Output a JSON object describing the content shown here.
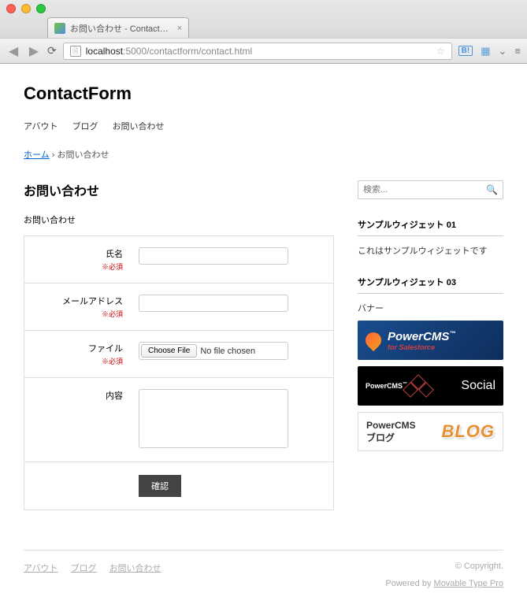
{
  "browser": {
    "tab_title": "お問い合わせ - ContactForm",
    "url_host": "localhost",
    "url_path": ":5000/contactform/contact.html",
    "bookmark_label": "B!"
  },
  "site": {
    "title": "ContactForm"
  },
  "nav": {
    "items": [
      "アバウト",
      "ブログ",
      "お問い合わせ"
    ]
  },
  "breadcrumb": {
    "home": "ホーム",
    "separator": "›",
    "current": "お問い合わせ"
  },
  "page": {
    "heading": "お問い合わせ",
    "subtext": "お問い合わせ"
  },
  "form": {
    "required_label": "※必須",
    "fields": {
      "name": {
        "label": "氏名"
      },
      "email": {
        "label": "メールアドレス"
      },
      "file": {
        "label": "ファイル",
        "button": "Choose File",
        "status": "No file chosen"
      },
      "content": {
        "label": "内容"
      }
    },
    "submit": "確認"
  },
  "sidebar": {
    "search_placeholder": "検索...",
    "widget1": {
      "title": "サンプルウィジェット 01",
      "body": "これはサンプルウィジェットです"
    },
    "widget3": {
      "title": "サンプルウィジェット 03",
      "body": "バナー"
    },
    "banners": {
      "b1_title": "PowerCMS",
      "b1_sub": "for Salesforce",
      "b2_left": "PowerCMS",
      "b2_right": "Social",
      "b3_left_line1": "PowerCMS",
      "b3_left_line2": "ブログ",
      "b3_right": "BLOG"
    }
  },
  "footer": {
    "nav": [
      "アバウト",
      "ブログ",
      "お問い合わせ"
    ],
    "copyright": "© Copyright.",
    "credit_prefix": "Powered by ",
    "credit_link": "Movable Type Pro"
  }
}
